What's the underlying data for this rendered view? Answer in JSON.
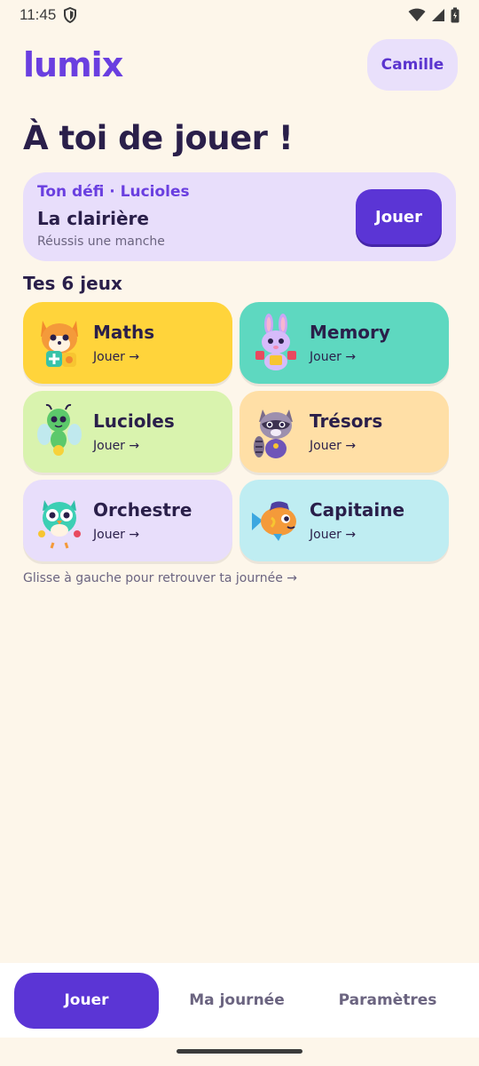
{
  "status_bar": {
    "time": "11:45"
  },
  "header": {
    "logo": "lumix",
    "profile_label": "Camille"
  },
  "page_title": "À toi de jouer !",
  "challenge": {
    "kicker": "Ton défi · Lucioles",
    "title": "La clairière",
    "subtitle": "Réussis une manche",
    "play_label": "Jouer"
  },
  "games_section_title": "Tes 6 jeux",
  "games": [
    {
      "name": "Maths",
      "cta": "Jouer →",
      "color": "#FFD43B",
      "icon": "fox-mascot-icon"
    },
    {
      "name": "Memory",
      "cta": "Jouer →",
      "color": "#5ED8C0",
      "icon": "bunny-mascot-icon"
    },
    {
      "name": "Lucioles",
      "cta": "Jouer →",
      "color": "#D9F3AE",
      "icon": "firefly-mascot-icon"
    },
    {
      "name": "Trésors",
      "cta": "Jouer →",
      "color": "#FFDFA6",
      "icon": "raccoon-mascot-icon"
    },
    {
      "name": "Orchestre",
      "cta": "Jouer →",
      "color": "#E8DEFB",
      "icon": "owl-mascot-icon"
    },
    {
      "name": "Capitaine",
      "cta": "Jouer →",
      "color": "#BFEDF2",
      "icon": "fish-mascot-icon"
    }
  ],
  "hint": "Glisse à gauche pour retrouver ta journée →",
  "nav": {
    "play": "Jouer",
    "journal": "Ma journée",
    "settings": "Paramètres"
  },
  "colors": {
    "background": "#FDF6EA",
    "accent": "#5B35D5",
    "text": "#2A1F4A"
  }
}
